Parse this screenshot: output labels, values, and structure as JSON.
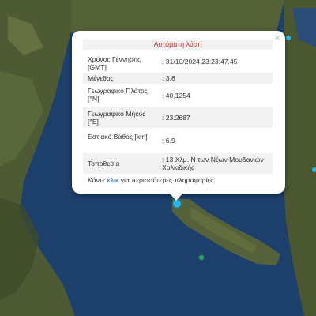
{
  "popup": {
    "title": "Αυτόματη λύση",
    "close_label": "×",
    "rows": [
      {
        "label": "Χρόνος Γέννησης [GMT]",
        "value": ": 31/10/2024 23:23:47.45"
      },
      {
        "label": "Μέγεθος",
        "value": ": 3.8"
      },
      {
        "label": "Γεωγραφικό Πλάτος [°N]",
        "value": ": 40.1254"
      },
      {
        "label": "Γεωγραφικό Μήκος [°E]",
        "value": ": 23.2687"
      },
      {
        "label": "Εστιακό Βάθος [km]",
        "value": ": 6.9"
      },
      {
        "label": "Τοποθεσία",
        "value": ": 13 Χλμ. N των Νέων Μουδανιών Χαλκιδικής"
      }
    ],
    "footer": {
      "prefix": "Κάντε ",
      "link": "κλικ",
      "suffix": " για περισσότερες πληροφορίες"
    }
  },
  "map": {
    "marker_color": "#29b6e8",
    "other_marker_color": "#1fa85a",
    "sea_color": "#1d3f6b",
    "land_color": "#4d5a33"
  }
}
